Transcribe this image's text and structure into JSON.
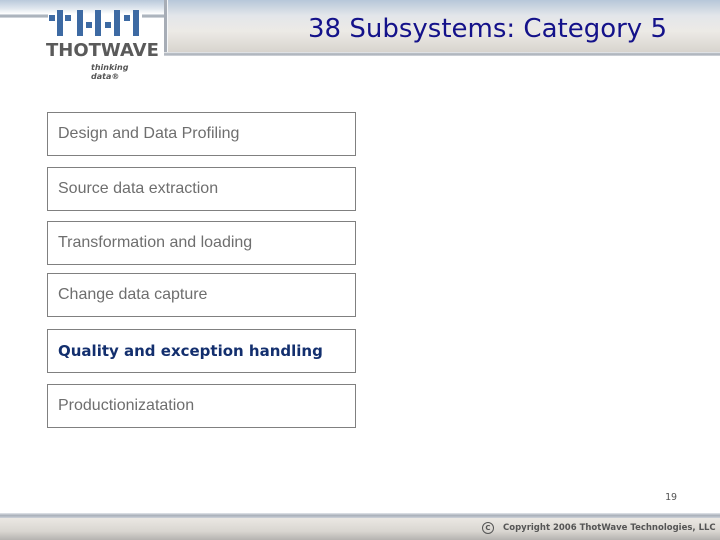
{
  "header": {
    "title": "38 Subsystems: Category 5"
  },
  "logo": {
    "wordmark": "THOTWAVE",
    "tagline": "thinking data®",
    "brand_color": "#3d6aa3"
  },
  "items": [
    {
      "label": "Design and Data Profiling",
      "active": false
    },
    {
      "label": "Source data extraction",
      "active": false
    },
    {
      "label": "Transformation and loading",
      "active": false
    },
    {
      "label": "Change data capture",
      "active": false
    },
    {
      "label": "Quality and exception handling",
      "active": true
    },
    {
      "label": "Productionizatation",
      "active": false
    }
  ],
  "colors": {
    "title": "#14128a",
    "active_item": "#132f6e",
    "inactive_item": "#6e6e6e"
  },
  "page_number": "19",
  "footer": {
    "copyright_icon": "copyright-icon",
    "copyright_symbol": "C",
    "copyright_text": "Copyright 2006 ThotWave Technologies, LLC"
  }
}
